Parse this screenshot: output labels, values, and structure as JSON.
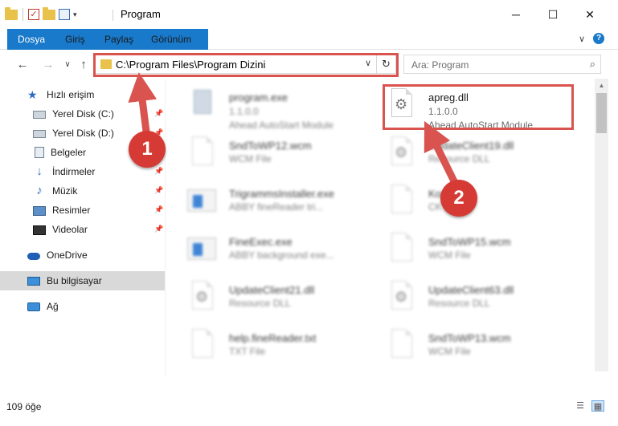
{
  "window": {
    "title": "Program",
    "minimize": "─",
    "maximize": "☐",
    "close": "✕"
  },
  "ribbon": {
    "tabs": [
      "Dosya",
      "Giriş",
      "Paylaş",
      "Görünüm"
    ],
    "expand_glyph": "∨",
    "help_glyph": "?"
  },
  "navigation": {
    "back_glyph": "←",
    "forward_glyph": "→",
    "recent_glyph": "∨",
    "up_glyph": "↑",
    "address": "C:\\Program Files\\Program Dizini",
    "address_dropdown": "∨",
    "refresh_glyph": "↻",
    "search_placeholder": "Ara: Program",
    "search_glyph": "⌕"
  },
  "sidebar": {
    "items": [
      {
        "label": "Hızlı erişim",
        "icon": "star-icon",
        "pinned": false
      },
      {
        "label": "Yerel Disk (C:)",
        "icon": "disk-icon",
        "pinned": true
      },
      {
        "label": "Yerel Disk (D:)",
        "icon": "disk-icon",
        "pinned": true
      },
      {
        "label": "Belgeler",
        "icon": "documents-icon",
        "pinned": true
      },
      {
        "label": "İndirmeler",
        "icon": "download-icon",
        "pinned": true
      },
      {
        "label": "Müzik",
        "icon": "music-icon",
        "pinned": true
      },
      {
        "label": "Resimler",
        "icon": "pictures-icon",
        "pinned": true
      },
      {
        "label": "Videolar",
        "icon": "video-icon",
        "pinned": true
      },
      {
        "label": "OneDrive",
        "icon": "onedrive-icon",
        "pinned": false
      },
      {
        "label": "Bu bilgisayar",
        "icon": "computer-icon",
        "pinned": false,
        "selected": true
      },
      {
        "label": "Ağ",
        "icon": "network-icon",
        "pinned": false
      }
    ]
  },
  "files": [
    {
      "name": "program.exe",
      "line2": "1.1.0.0",
      "line3": "Ahead AutoStart Module",
      "kind": "exe",
      "blurred": true
    },
    {
      "name": "apreg.dll",
      "line2": "1.1.0.0",
      "line3": "Ahead AutoStart Module",
      "kind": "dll",
      "blurred": false
    },
    {
      "name": "SndToWP12.wcm",
      "line2": "WCM File",
      "line3": "",
      "kind": "doc",
      "blurred": true
    },
    {
      "name": "UpdateClient19.dll",
      "line2": "Resource DLL",
      "line3": "",
      "kind": "dll",
      "blurred": true
    },
    {
      "name": "TrigrammsInstaller.exe",
      "line2": "ABBY fineReader tri...",
      "line3": "",
      "kind": "app",
      "blurred": true
    },
    {
      "name": "Kor...",
      "line2": "CK ...",
      "line3": "",
      "kind": "doc",
      "blurred": true
    },
    {
      "name": "FineExec.exe",
      "line2": "ABBY background exe...",
      "line3": "",
      "kind": "app",
      "blurred": true
    },
    {
      "name": "SndToWP15.wcm",
      "line2": "WCM File",
      "line3": "",
      "kind": "doc",
      "blurred": true
    },
    {
      "name": "UpdateClient21.dll",
      "line2": "Resource DLL",
      "line3": "",
      "kind": "dll",
      "blurred": true
    },
    {
      "name": "UpdateClient63.dll",
      "line2": "Resource DLL",
      "line3": "",
      "kind": "dll",
      "blurred": true
    },
    {
      "name": "help.fineReader.txt",
      "line2": "TXT File",
      "line3": "",
      "kind": "doc",
      "blurred": true
    },
    {
      "name": "SndToWP13.wcm",
      "line2": "WCM File",
      "line3": "",
      "kind": "doc",
      "blurred": true
    }
  ],
  "status": {
    "item_count": "109 öğe"
  },
  "annotations": {
    "step1": "1",
    "step2": "2",
    "color": "#d9534f"
  }
}
